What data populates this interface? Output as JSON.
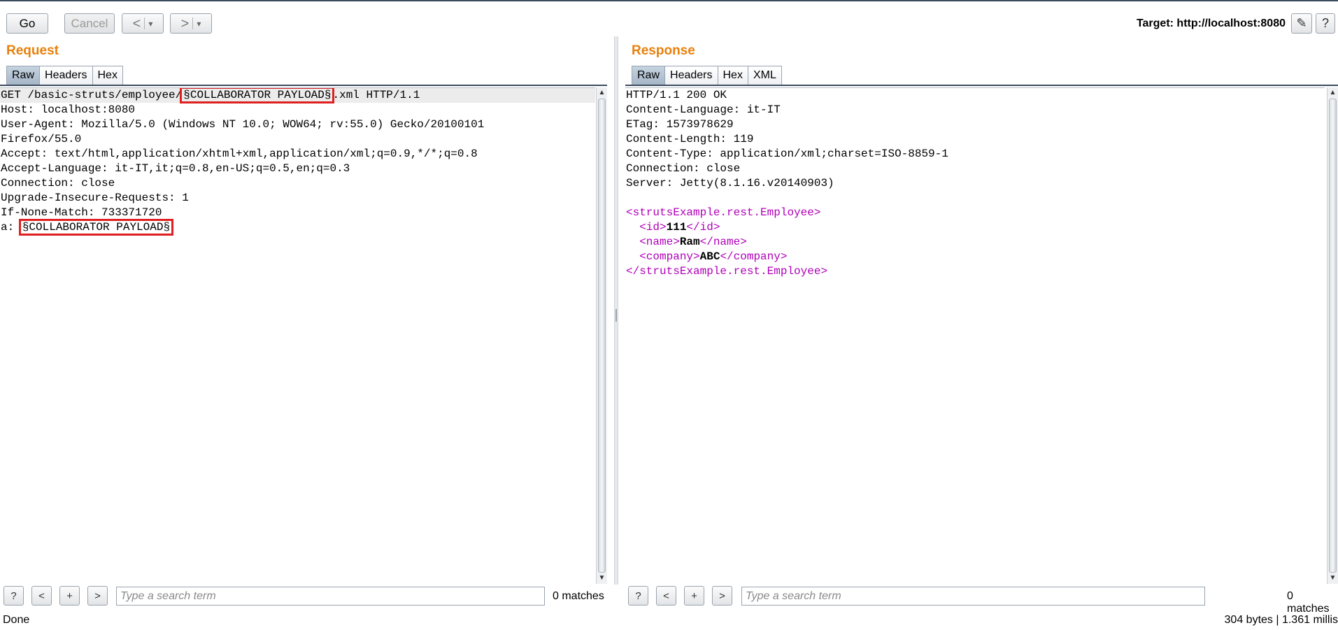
{
  "toolbar": {
    "go_label": "Go",
    "cancel_label": "Cancel",
    "back_label": "<",
    "forward_label": ">",
    "dropdown_arrow": "▾",
    "target_label": "Target: http://localhost:8080",
    "edit_icon_glyph": "✎",
    "help_icon_glyph": "?"
  },
  "request": {
    "title": "Request",
    "tabs": [
      "Raw",
      "Headers",
      "Hex"
    ],
    "active_tab": "Raw",
    "lines": {
      "l1_a": "GET /basic-struts/employee/",
      "l1_payload": "§COLLABORATOR PAYLOAD§",
      "l1_b": ".xml HTTP/1.1",
      "l2": "Host: localhost:8080",
      "l3": "User-Agent: Mozilla/5.0 (Windows NT 10.0; WOW64; rv:55.0) Gecko/20100101",
      "l4": "Firefox/55.0",
      "l5": "Accept: text/html,application/xhtml+xml,application/xml;q=0.9,*/*;q=0.8",
      "l6": "Accept-Language: it-IT,it;q=0.8,en-US;q=0.5,en;q=0.3",
      "l7": "Connection: close",
      "l8": "Upgrade-Insecure-Requests: 1",
      "l9": "If-None-Match: 733371720",
      "l10_a": "a: ",
      "l10_payload": "§COLLABORATOR PAYLOAD§"
    },
    "search": {
      "help": "?",
      "prev": "<",
      "add": "+",
      "next": ">",
      "placeholder": "Type a search term",
      "matches": "0 matches"
    }
  },
  "response": {
    "title": "Response",
    "tabs": [
      "Raw",
      "Headers",
      "Hex",
      "XML"
    ],
    "active_tab": "Raw",
    "headers": [
      "HTTP/1.1 200 OK",
      "Content-Language: it-IT",
      "ETag: 1573978629",
      "Content-Length: 119",
      "Content-Type: application/xml;charset=ISO-8859-1",
      "Connection: close",
      "Server: Jetty(8.1.16.v20140903)"
    ],
    "xml": {
      "root_open": "<strutsExample.rest.Employee>",
      "id_open": "<id>",
      "id_value": "111",
      "id_close": "</id>",
      "name_open": "<name>",
      "name_value": "Ram",
      "name_close": "</name>",
      "company_open": "<company>",
      "company_value": "ABC",
      "company_close": "</company>",
      "root_close": "</strutsExample.rest.Employee>"
    },
    "search": {
      "help": "?",
      "prev": "<",
      "add": "+",
      "next": ">",
      "placeholder": "Type a search term",
      "matches": "0 matches"
    }
  },
  "status": {
    "left": "Done",
    "right": "304 bytes | 1.361 millis"
  },
  "colors": {
    "title_orange": "#e8800c",
    "xml_tag": "#b000b8",
    "highlight_red": "#e02020"
  }
}
